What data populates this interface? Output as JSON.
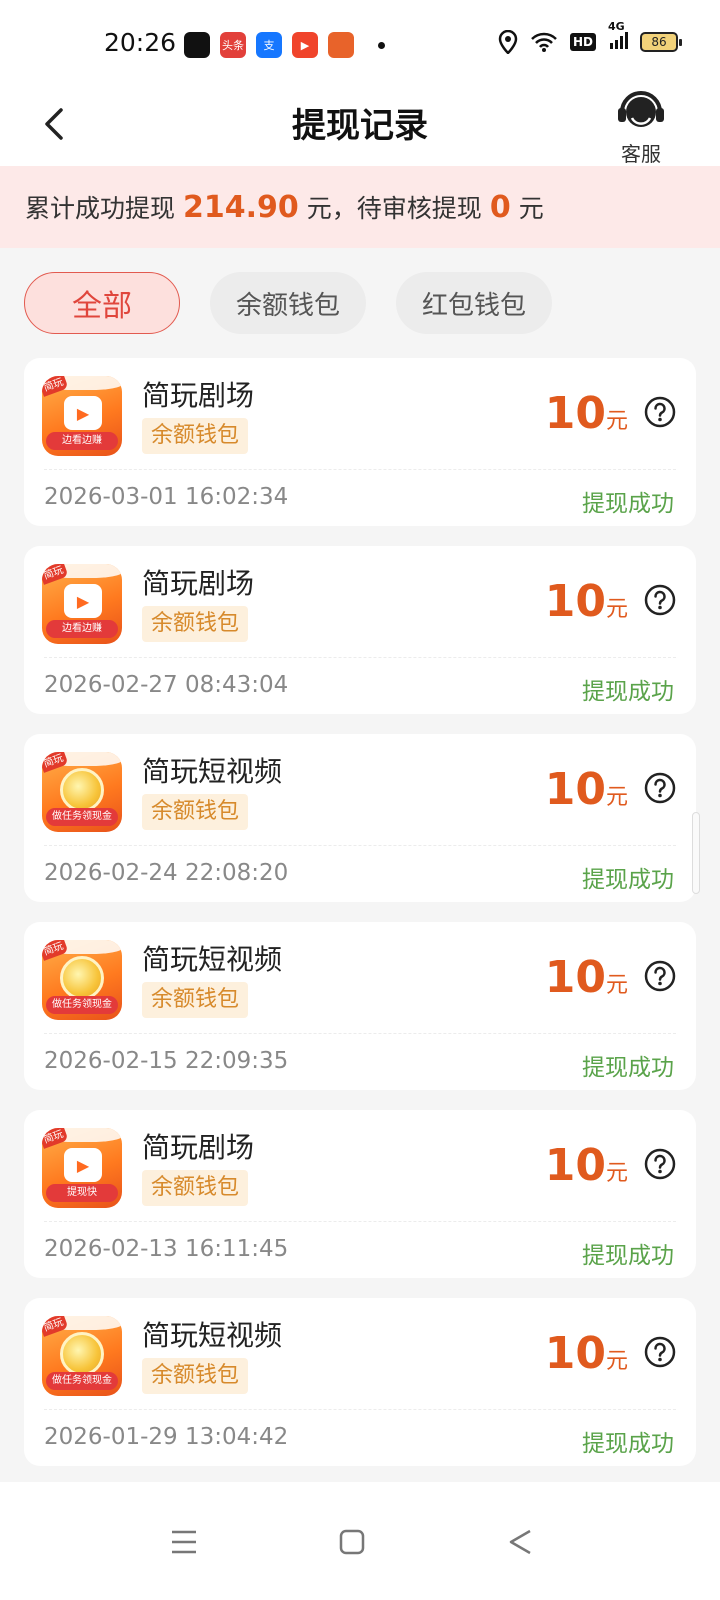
{
  "status_bar": {
    "time": "20:26",
    "battery": "86",
    "hd": "HD",
    "network": "4G",
    "app_icons": [
      {
        "name": "wechat-icon",
        "label": "",
        "color": "#111111"
      },
      {
        "name": "toutiao-icon",
        "label": "头条",
        "color": "#e2403a"
      },
      {
        "name": "alipay-icon",
        "label": "支",
        "color": "#1677ff"
      },
      {
        "name": "video-app-icon",
        "label": "▶",
        "color": "#f0442b"
      },
      {
        "name": "game-app-icon",
        "label": "",
        "color": "#e8632a"
      }
    ]
  },
  "header": {
    "title": "提现记录",
    "service_label": "客服"
  },
  "summary": {
    "prefix": "累计成功提现",
    "total": "214.90",
    "mid": "元，待审核提现",
    "pending": "0",
    "suffix": "元"
  },
  "filters": [
    {
      "label": "全部",
      "active": true
    },
    {
      "label": "余额钱包",
      "active": false
    },
    {
      "label": "红包钱包",
      "active": false
    }
  ],
  "records": [
    {
      "app_name": "简玩剧场",
      "wallet": "余额钱包",
      "amount": "10",
      "unit": "元",
      "date": "2026-03-01 16:02:34",
      "status": "提现成功",
      "icon_type": "video",
      "icon_band": "边看边赚"
    },
    {
      "app_name": "简玩剧场",
      "wallet": "余额钱包",
      "amount": "10",
      "unit": "元",
      "date": "2026-02-27 08:43:04",
      "status": "提现成功",
      "icon_type": "video",
      "icon_band": "边看边赚"
    },
    {
      "app_name": "简玩短视频",
      "wallet": "余额钱包",
      "amount": "10",
      "unit": "元",
      "date": "2026-02-24 22:08:20",
      "status": "提现成功",
      "icon_type": "coin",
      "icon_band": "做任务领现金"
    },
    {
      "app_name": "简玩短视频",
      "wallet": "余额钱包",
      "amount": "10",
      "unit": "元",
      "date": "2026-02-15 22:09:35",
      "status": "提现成功",
      "icon_type": "coin",
      "icon_band": "做任务领现金"
    },
    {
      "app_name": "简玩剧场",
      "wallet": "余额钱包",
      "amount": "10",
      "unit": "元",
      "date": "2026-02-13 16:11:45",
      "status": "提现成功",
      "icon_type": "video",
      "icon_band": "提现快"
    },
    {
      "app_name": "简玩短视频",
      "wallet": "余额钱包",
      "amount": "10",
      "unit": "元",
      "date": "2026-01-29 13:04:42",
      "status": "提现成功",
      "icon_type": "coin",
      "icon_band": "做任务领现金"
    }
  ],
  "icon_tag": "简玩",
  "colors": {
    "accent": "#e05a1e",
    "success": "#5aa34a",
    "wallet_tag_text": "#d78a2c",
    "banner_bg": "#fde9e8"
  }
}
